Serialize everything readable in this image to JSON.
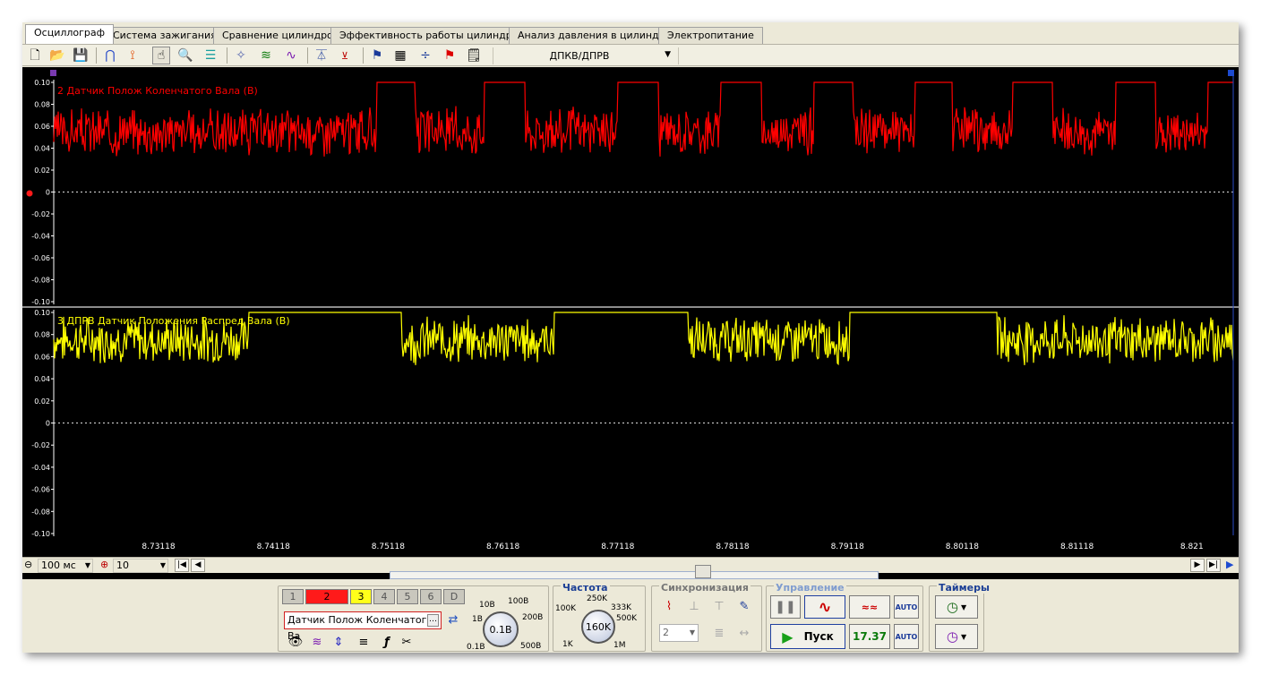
{
  "tabs": [
    {
      "label": "Осциллограф",
      "active": true
    },
    {
      "label": "Система зажигания"
    },
    {
      "label": "Сравнение цилиндров"
    },
    {
      "label": "Эффективность работы цилиндров"
    },
    {
      "label": "Анализ давления в цилиндре"
    },
    {
      "label": "Электропитание"
    }
  ],
  "toolbar": {
    "preset_value": "ДПКВ/ДПРВ",
    "icons": [
      "new-file-icon",
      "open-folder-icon",
      "save-disk-icon",
      "cursor-a-icon",
      "cursor-b-icon",
      "hand-pan-icon",
      "zoom-icon",
      "filter-icon",
      "center-icon",
      "waves-icon",
      "spectrum-icon",
      "auto-scale-icon",
      "zero-level-icon",
      "marker-flag-icon",
      "table-icon",
      "divide-icon",
      "red-flag-icon",
      "notes-icon"
    ]
  },
  "chart_data": [
    {
      "type": "line",
      "title": "2 Датчик Полож Коленчатого Вала (В)",
      "color": "#ff0000",
      "ylim": [
        -0.1,
        0.1
      ],
      "y_ticks": [
        "0.10",
        "0.08",
        "0.06",
        "0.04",
        "0.02",
        "0",
        "-0.02",
        "-0.04",
        "-0.06",
        "-0.08",
        "-0.10"
      ],
      "description_levels": {
        "high": 0.1,
        "noise_mean": 0.055
      },
      "high_segments": [
        [
          0.274,
          0.306
        ],
        [
          0.365,
          0.4
        ],
        [
          0.478,
          0.513
        ],
        [
          0.565,
          0.6
        ],
        [
          0.644,
          0.678
        ],
        [
          0.73,
          0.762
        ],
        [
          0.813,
          0.847
        ],
        [
          0.9,
          0.934
        ],
        [
          0.978,
          1.0
        ]
      ]
    },
    {
      "type": "line",
      "title": "3 ДПРВ Датчик Положения Распред Вала (В)",
      "color": "#ffff00",
      "ylim": [
        -0.1,
        0.1
      ],
      "y_ticks": [
        "0.10",
        "0.08",
        "0.06",
        "0.04",
        "0.02",
        "0",
        "-0.02",
        "-0.04",
        "-0.06",
        "-0.08",
        "-0.10"
      ],
      "description_levels": {
        "high": 0.1,
        "noise_mean": 0.075
      },
      "high_segments": [
        [
          0.165,
          0.295
        ],
        [
          0.424,
          0.538
        ],
        [
          0.675,
          0.8
        ]
      ],
      "x_ticks": [
        "8.73118",
        "8.74118",
        "8.75118",
        "8.76118",
        "8.77118",
        "8.78118",
        "8.79118",
        "8.80118",
        "8.81118",
        "8.821"
      ]
    }
  ],
  "bottom": {
    "timebase": "100 мс",
    "samples": "10"
  },
  "channel_panel": {
    "channels": [
      "1",
      "2",
      "3",
      "4",
      "5",
      "6",
      "D"
    ],
    "selected_channel": "2",
    "sensor_name": "Датчик Полож Коленчатого Ва",
    "voltage_value": "0.1В",
    "voltage_scale": [
      "0.1В",
      "1В",
      "10В",
      "100В",
      "200В",
      "500В"
    ]
  },
  "frequency": {
    "title": "Частота",
    "value": "160K",
    "scale": [
      "1K",
      "100K",
      "250K",
      "333K",
      "500K",
      "1M"
    ]
  },
  "sync": {
    "title": "Синхронизация",
    "channel_select": "2"
  },
  "control": {
    "title": "Управление",
    "start_label": "Пуск",
    "value": "17.37"
  },
  "timers": {
    "title": "Таймеры"
  }
}
